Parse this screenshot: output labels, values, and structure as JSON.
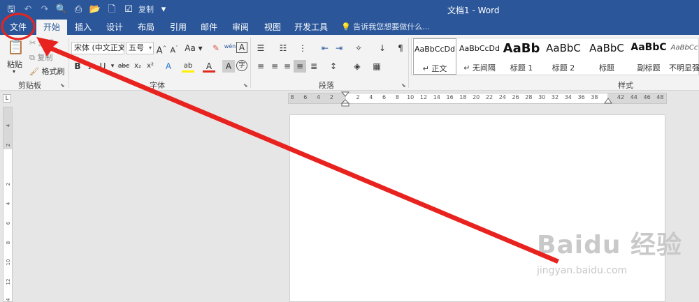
{
  "window": {
    "title": "文档1 - Word"
  },
  "quick_access": {
    "checkbox_label": "复制"
  },
  "tabs": [
    {
      "label": "文件"
    },
    {
      "label": "开始"
    },
    {
      "label": "插入"
    },
    {
      "label": "设计"
    },
    {
      "label": "布局"
    },
    {
      "label": "引用"
    },
    {
      "label": "邮件"
    },
    {
      "label": "审阅"
    },
    {
      "label": "视图"
    },
    {
      "label": "开发工具"
    }
  ],
  "tell_me": {
    "placeholder": "告诉我您想要做什么..."
  },
  "clipboard": {
    "paste_label": "粘贴",
    "cut_label": "剪切",
    "copy_label": "复制",
    "format_painter_label": "格式刷",
    "group_label": "剪贴板"
  },
  "font": {
    "font_name": "宋体 (中文正文",
    "font_size": "五号",
    "case_label": "Aa",
    "group_label": "字体",
    "grow_label": "A",
    "phonetic_label": "wén",
    "bold": "B",
    "italic": "I",
    "underline": "U",
    "strike": "abc",
    "sub": "x₂",
    "sup": "x²",
    "text_effect": "A",
    "highlight": "ab",
    "font_color": "A",
    "shade": "A",
    "enclose": "字"
  },
  "paragraph": {
    "group_label": "段落"
  },
  "styles": {
    "group_label": "样式",
    "items": [
      {
        "sample": "AaBbCcDd",
        "name": "↵ 正文"
      },
      {
        "sample": "AaBbCcDd",
        "name": "↵ 无间隔"
      },
      {
        "sample": "AaBb",
        "name": "标题 1"
      },
      {
        "sample": "AaBbC",
        "name": "标题 2"
      },
      {
        "sample": "AaBbC",
        "name": "标题"
      },
      {
        "sample": "AaBbC",
        "name": "副标题"
      },
      {
        "sample": "AaBbCc",
        "name": "不明显强"
      }
    ]
  },
  "ruler": {
    "h_labels": [
      "8",
      "6",
      "4",
      "2",
      "",
      "2",
      "4",
      "6",
      "8",
      "10",
      "12",
      "14",
      "16",
      "18",
      "20",
      "22",
      "24",
      "26",
      "28",
      "30",
      "32",
      "34",
      "36",
      "38",
      "",
      "42",
      "44",
      "46",
      "48"
    ],
    "v_labels": [
      "4",
      "2",
      "",
      "2",
      "4",
      "6",
      "8",
      "10",
      "12",
      "14"
    ],
    "corner": "L"
  },
  "watermark": {
    "main": "Baidu 经验",
    "sub": "jingyan.baidu.com"
  },
  "colors": {
    "titlebar": "#2b579a",
    "annotation": "#e8231f"
  }
}
